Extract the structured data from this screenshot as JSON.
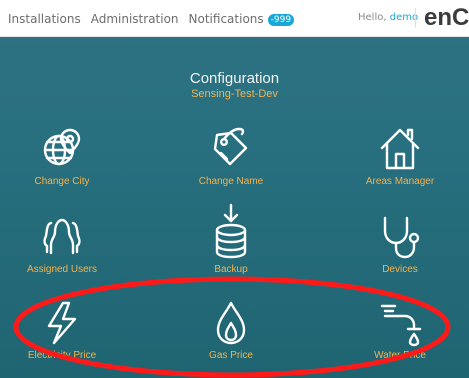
{
  "nav": {
    "items": [
      {
        "label": "Installations"
      },
      {
        "label": "Administration"
      },
      {
        "label": "Notifications"
      }
    ],
    "notification_badge": "-999"
  },
  "user": {
    "greeting": "Hello,",
    "name": "demo"
  },
  "brand": {
    "name": "enCo"
  },
  "header": {
    "title": "Configuration",
    "subtitle": "Sensing-Test-Dev"
  },
  "actions": [
    {
      "label": "Change City",
      "icon": "globe-location-icon"
    },
    {
      "label": "Change Name",
      "icon": "tag-icon"
    },
    {
      "label": "Areas Manager",
      "icon": "house-icon"
    },
    {
      "label": "Assigned Users",
      "icon": "users-icon"
    },
    {
      "label": "Backup",
      "icon": "database-download-icon"
    },
    {
      "label": "Devices",
      "icon": "stethoscope-icon"
    },
    {
      "label": "Electricity Price",
      "icon": "lightning-icon"
    },
    {
      "label": "Gas Price",
      "icon": "flame-icon"
    },
    {
      "label": "Water Price",
      "icon": "water-tap-icon"
    }
  ],
  "theme": {
    "accent": "#f5b24b",
    "background": "#287080",
    "highlight": "#ff1a1a",
    "link": "#18a7d7"
  }
}
